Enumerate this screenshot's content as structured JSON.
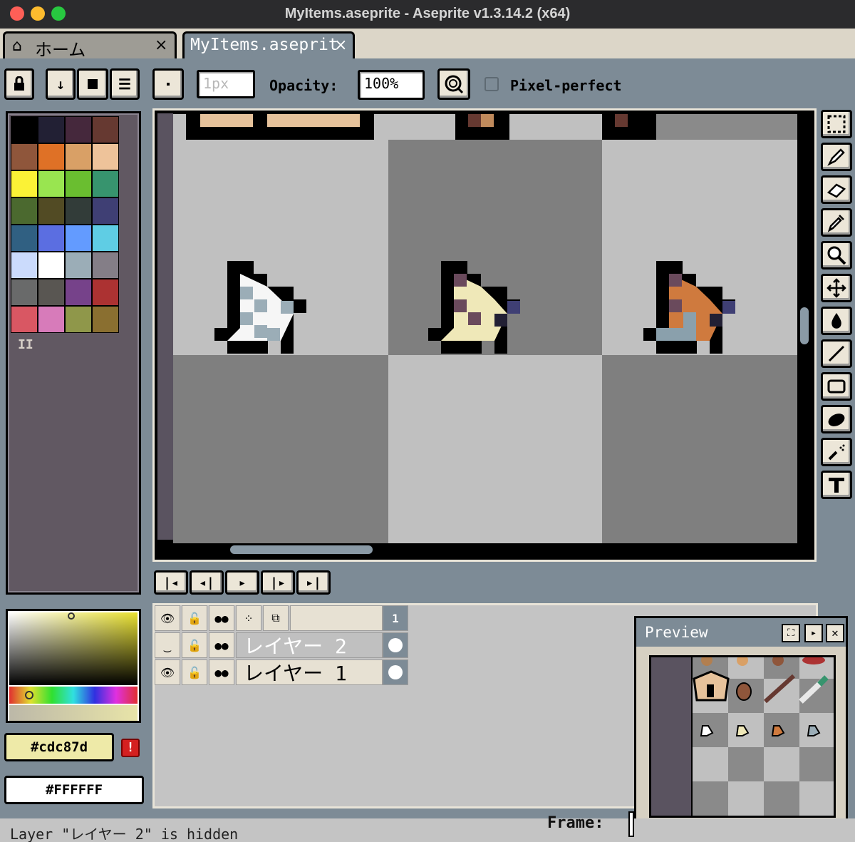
{
  "window": {
    "title": "MyItems.aseprite - Aseprite v1.3.14.2 (x64)"
  },
  "tabs": [
    {
      "label": "ホーム",
      "close": "×"
    },
    {
      "label": "MyItems.aseprit",
      "close": "×"
    }
  ],
  "toolbar": {
    "brush_size": "1px",
    "opacity_label": "Opacity:",
    "opacity_value": "100%",
    "pixel_perfect_label": "Pixel-perfect",
    "pixel_perfect_checked": false
  },
  "palette": {
    "colors": [
      "#000000",
      "#222034",
      "#45283c",
      "#663931",
      "#8f563b",
      "#df7126",
      "#d9a066",
      "#eec39a",
      "#fbf236",
      "#99e550",
      "#6abe30",
      "#37946e",
      "#4b692f",
      "#524b24",
      "#323c39",
      "#3f3f74",
      "#306082",
      "#5b6ee1",
      "#639bff",
      "#5fcde4",
      "#cbdbfc",
      "#ffffff",
      "#9badb7",
      "#847e87",
      "#696a6a",
      "#595652",
      "#76428a",
      "#ac3232",
      "#d95763",
      "#d77bba",
      "#8f974a",
      "#8a6f30"
    ],
    "handle": "II"
  },
  "color_picker": {
    "fg_hex": "#cdc87d",
    "bg_hex": "#FFFFFF",
    "fg_color": "#eeeaa8",
    "bg_color": "#ffffff",
    "warning_icon": "!"
  },
  "tools": [
    "rectangular-marquee-icon",
    "pencil-icon",
    "eraser-icon",
    "eyedropper-icon",
    "zoom-icon",
    "move-icon",
    "paint-bucket-icon",
    "line-icon",
    "rectangle-icon",
    "contour-icon",
    "spray-icon",
    "text-icon"
  ],
  "timeline": {
    "frame_number": "1",
    "layers": [
      {
        "name": "レイヤー 2",
        "visible": false
      },
      {
        "name": "レイヤー 1",
        "visible": true
      }
    ]
  },
  "preview": {
    "title": "Preview"
  },
  "status": {
    "message": "Layer \"レイヤー 2\" is hidden",
    "frame_label": "Frame:"
  }
}
